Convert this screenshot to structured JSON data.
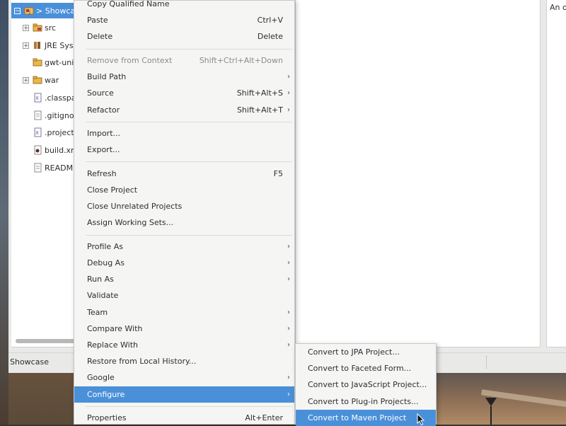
{
  "explorer": {
    "items": [
      {
        "label": "> Showcase",
        "icon": "project-icon",
        "expander": "⊟",
        "selected": true
      },
      {
        "label": "src",
        "icon": "source-folder-icon",
        "expander": "+"
      },
      {
        "label": "JRE System Library",
        "icon": "library-icon",
        "expander": "+"
      },
      {
        "label": "gwt-unitCache",
        "icon": "folder-icon",
        "expander": ""
      },
      {
        "label": "war",
        "icon": "folder-icon",
        "expander": "+"
      },
      {
        "label": ".classpath",
        "icon": "xml-file-icon",
        "expander": ""
      },
      {
        "label": ".gitignore",
        "icon": "text-file-icon",
        "expander": ""
      },
      {
        "label": ".project",
        "icon": "xml-file-icon",
        "expander": ""
      },
      {
        "label": "build.xml",
        "icon": "ant-file-icon",
        "expander": ""
      },
      {
        "label": "README",
        "icon": "text-file-icon",
        "expander": ""
      }
    ]
  },
  "outline": {
    "text": "An o"
  },
  "status": {
    "text": "Showcase"
  },
  "context_menu": {
    "items": [
      {
        "label": "Copy Qualified Name",
        "shortcut": ""
      },
      {
        "label": "Paste",
        "shortcut": "Ctrl+V"
      },
      {
        "label": "Delete",
        "shortcut": "Delete"
      },
      {
        "separator": true
      },
      {
        "label": "Remove from Context",
        "shortcut": "Shift+Ctrl+Alt+Down",
        "disabled": true
      },
      {
        "label": "Build Path",
        "submenu": true
      },
      {
        "label": "Source",
        "shortcut": "Shift+Alt+S",
        "submenu": true
      },
      {
        "label": "Refactor",
        "shortcut": "Shift+Alt+T",
        "submenu": true
      },
      {
        "separator": true
      },
      {
        "label": "Import..."
      },
      {
        "label": "Export..."
      },
      {
        "separator": true
      },
      {
        "label": "Refresh",
        "shortcut": "F5"
      },
      {
        "label": "Close Project"
      },
      {
        "label": "Close Unrelated Projects"
      },
      {
        "label": "Assign Working Sets..."
      },
      {
        "separator": true
      },
      {
        "label": "Profile As",
        "submenu": true
      },
      {
        "label": "Debug As",
        "submenu": true
      },
      {
        "label": "Run As",
        "submenu": true
      },
      {
        "label": "Validate"
      },
      {
        "label": "Team",
        "submenu": true
      },
      {
        "label": "Compare With",
        "submenu": true
      },
      {
        "label": "Replace With",
        "submenu": true
      },
      {
        "label": "Restore from Local History..."
      },
      {
        "label": "Google",
        "submenu": true
      },
      {
        "label": "Configure",
        "submenu": true,
        "active": true
      },
      {
        "separator": true
      },
      {
        "label": "Properties",
        "shortcut": "Alt+Enter"
      }
    ]
  },
  "submenu": {
    "items": [
      {
        "label": "Convert to JPA Project..."
      },
      {
        "label": "Convert to Faceted Form..."
      },
      {
        "label": "Convert to JavaScript Project..."
      },
      {
        "label": "Convert to Plug-in Projects..."
      },
      {
        "label": "Convert to Maven Project",
        "active": true
      }
    ]
  },
  "colors": {
    "selection": "#4a90d9",
    "menu_bg": "#f5f5f4",
    "disabled_text": "#8c8c8c"
  }
}
